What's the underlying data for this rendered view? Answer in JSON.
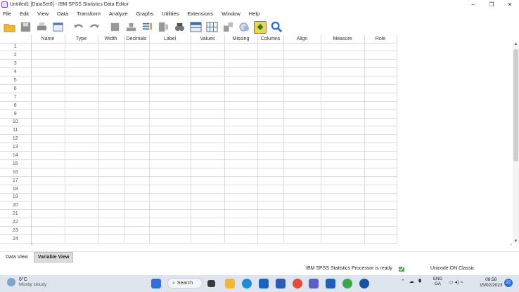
{
  "window": {
    "title": "Untitled1 [DataSet0] - IBM SPSS Statistics Data Editor",
    "controls": [
      "–",
      "❐",
      "✕"
    ]
  },
  "menu": [
    "File",
    "Edit",
    "View",
    "Data",
    "Transform",
    "Analyze",
    "Graphs",
    "Utilities",
    "Extensions",
    "Window",
    "Help"
  ],
  "toolbar": {
    "icons": [
      "open-folder-icon",
      "save-icon",
      "print-icon",
      "recall-dialog-icon",
      "undo-icon",
      "redo-icon",
      "goto-case-icon",
      "goto-variable-icon",
      "variables-icon",
      "split-file-icon",
      "find-icon",
      "insert-cases-icon",
      "insert-variable-icon",
      "weight-cases-icon",
      "value-labels-icon",
      "use-sets-icon",
      "search-icon"
    ]
  },
  "grid": {
    "columns": [
      "Name",
      "Type",
      "Width",
      "Decimals",
      "Label",
      "Values",
      "Missing",
      "Columns",
      "Align",
      "Measure",
      "Role"
    ],
    "rows": [
      "1",
      "2",
      "3",
      "4",
      "5",
      "6",
      "7",
      "8",
      "9",
      "10",
      "11",
      "12",
      "13",
      "14",
      "15",
      "16",
      "17",
      "18",
      "19",
      "20",
      "21",
      "22",
      "23",
      "24"
    ]
  },
  "tabs": {
    "data_view": "Data View",
    "variable_view": "Variable View"
  },
  "status": {
    "processor": "IBM SPSS Statistics Processor is ready",
    "unicode": "Unicode:ON  Classic"
  },
  "taskbar": {
    "weather_temp": "6°C",
    "weather_desc": "Mostly cloudy",
    "search": "Search",
    "lang_top": "ENG",
    "lang_bottom": "GA",
    "time": "08:58",
    "date": "15/02/2023",
    "notifications": "22"
  },
  "colors": {
    "accent": "#2f6fd6",
    "toolbar_highlight": "#f2d54a",
    "taskbar_bg": "#dfe5ee"
  }
}
